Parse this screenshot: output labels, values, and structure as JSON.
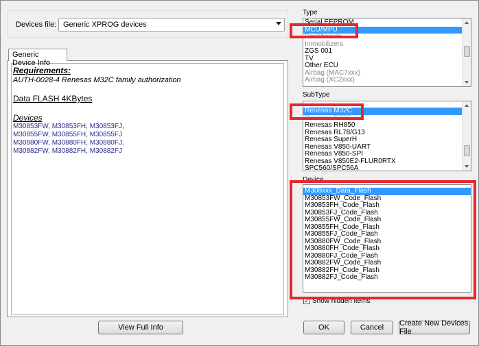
{
  "devices_file": {
    "label": "Devices file:",
    "value": "Generic XPROG devices"
  },
  "tab": {
    "label": "Generic Device Info"
  },
  "info": {
    "requirements_title": "Requirements:",
    "requirement_line": "AUTH-0028-4  Renesas M32C family authorization",
    "flash_line": "Data FLASH 4KBytes",
    "devices_title": "Devices",
    "device_lines": [
      "M30853FW, M30853FH, M30853FJ,",
      "M30855FW, M30855FH, M30855FJ",
      "M30880FW, M30880FH, M30880FJ,",
      "M30882FW, M30882FH, M30882FJ"
    ]
  },
  "view_full_info_button": "View Full Info",
  "type": {
    "label": "Type",
    "items": [
      "Serial EEPROM",
      "MCU/MPU",
      "Dashboards",
      "Immobilizers",
      "ZGS 001",
      "TV",
      "Other ECU",
      "Airbag (MAC7xxx)",
      "Airbag (XC2xxx)"
    ],
    "selected": "MCU/MPU"
  },
  "subtype": {
    "label": "SubType",
    "items": [
      "Renesas M32C",
      "Renesas R32C",
      "Renesas RH850",
      "Renesas RL78/G13",
      "Renesas SuperH",
      "Renesas V850-UART",
      "Renesas V850-SPI",
      "Renesas V850E2-FLUR0RTX",
      "SPC560/SPC56A"
    ],
    "selected": "Renesas M32C"
  },
  "device": {
    "label": "Device",
    "items": [
      "M308xxx_Data_Flash",
      "M30853FW_Code_Flash",
      "M30853FH_Code_Flash",
      "M30853FJ_Code_Flash",
      "M30855FW_Code_Flash",
      "M30855FH_Code_Flash",
      "M30855FJ_Code_Flash",
      "M30880FW_Code_Flash",
      "M30880FH_Code_Flash",
      "M30880FJ_Code_Flash",
      "M30882FW_Code_Flash",
      "M30882FH_Code_Flash",
      "M30882FJ_Code_Flash"
    ],
    "selected": "M308xxx_Data_Flash"
  },
  "show_hidden": {
    "label": "Show hidden items",
    "checked": true
  },
  "buttons": {
    "ok": "OK",
    "cancel": "Cancel",
    "create": "Create New Devices File"
  },
  "colors": {
    "selection": "#3399ff",
    "highlight_box": "#e8262d"
  }
}
